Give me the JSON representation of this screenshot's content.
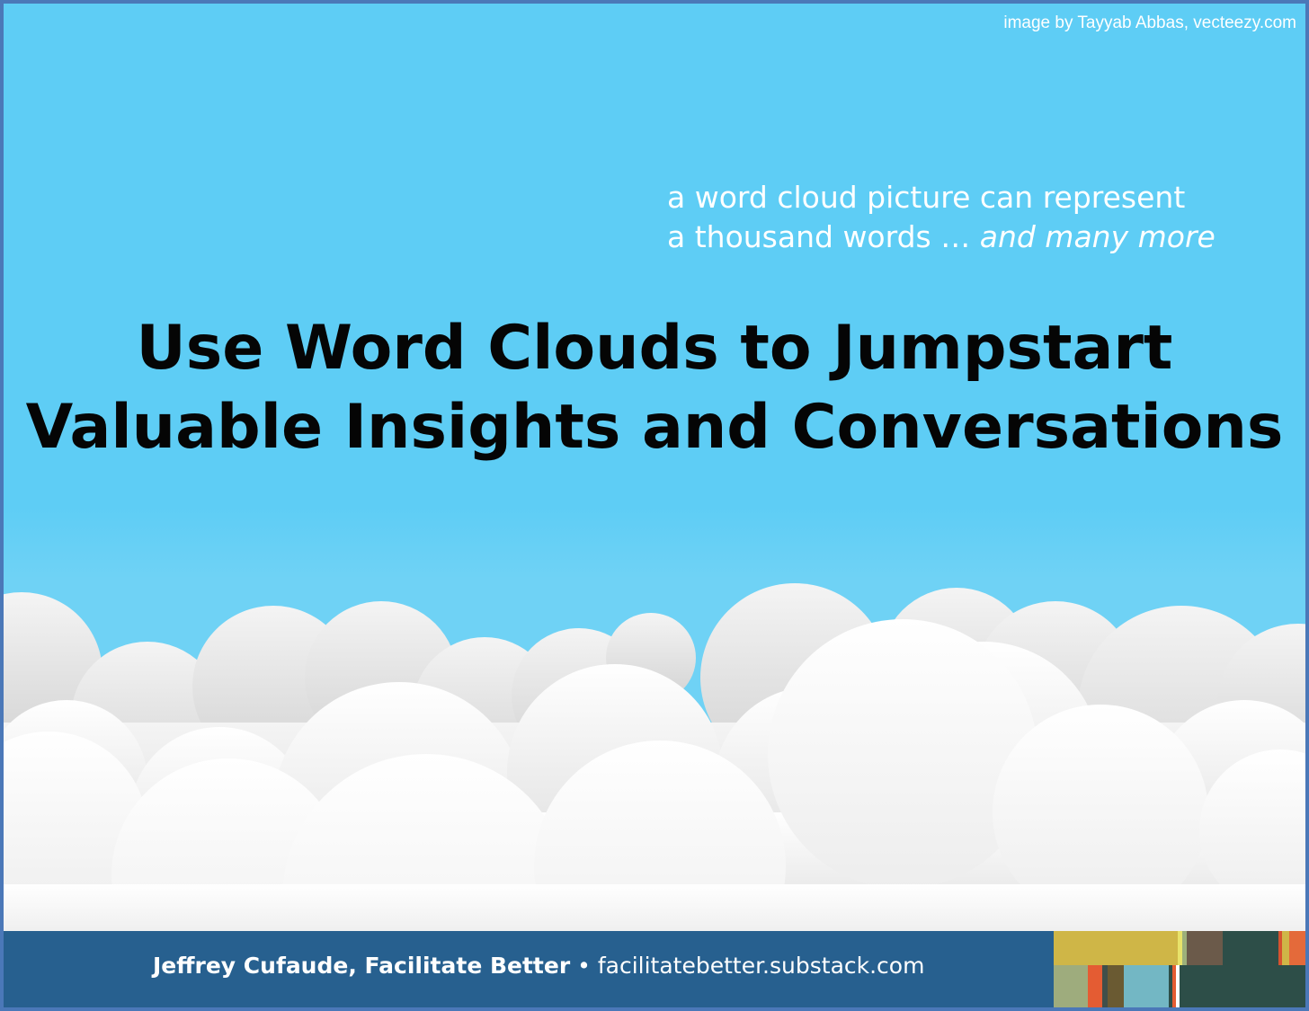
{
  "credit": "image by Tayyab Abbas, vecteezy.com",
  "tagline": {
    "line1": "a word cloud picture can represent",
    "line2_plain": "a thousand words … ",
    "line2_emphasis": "and many more"
  },
  "title": {
    "line1": "Use Word Clouds to Jumpstart",
    "line2": "Valuable Insights and Conversations"
  },
  "footer": {
    "author": "Jeffrey Cufaude, Facilitate Better",
    "separator": " • ",
    "url": "facilitatebetter.substack.com"
  },
  "colors": {
    "sky": "#5ecdf5",
    "footer_bar": "#27608f",
    "frame": "#4b78b8",
    "title_text": "#050505",
    "cloud_white": "#ffffff",
    "cloud_shadow": "#d9d9d9"
  },
  "decor": {
    "clouds": "cloud-bank-illustration",
    "stripes": "color-stripe-logo"
  }
}
